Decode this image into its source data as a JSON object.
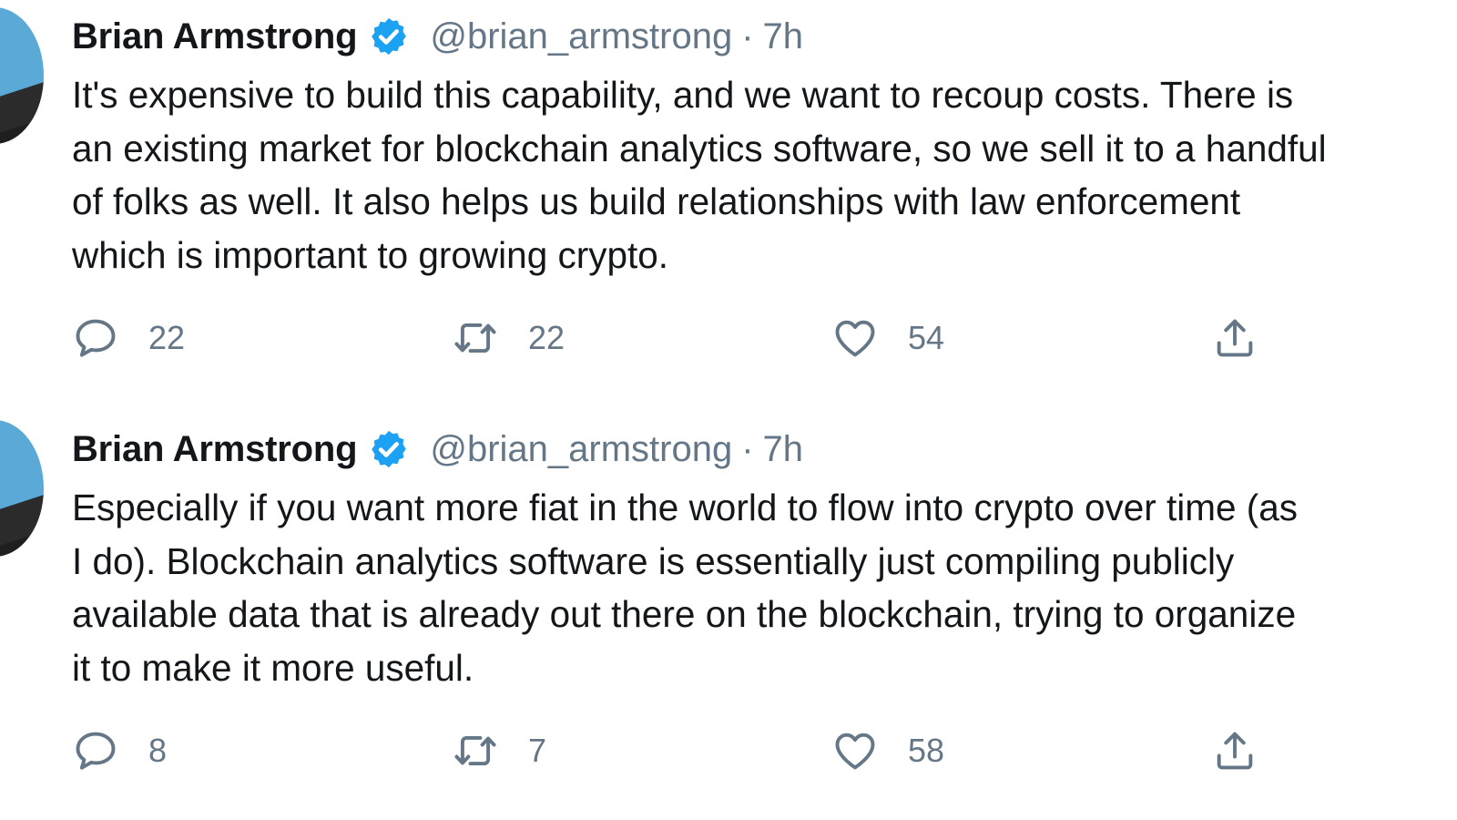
{
  "tweets": [
    {
      "author": "Brian Armstrong",
      "handle": "@brian_armstrong",
      "separator": "·",
      "time": "7h",
      "lines": [
        "It's expensive to build this capability, and we want to recoup costs. There is",
        "an existing market for blockchain analytics software, so we sell it to a handful",
        "of folks as well. It also helps us build relationships with law enforcement",
        "which is important to growing crypto."
      ],
      "replies": "22",
      "retweets": "22",
      "likes": "54"
    },
    {
      "author": "Brian Armstrong",
      "handle": "@brian_armstrong",
      "separator": "·",
      "time": "7h",
      "lines": [
        "Especially if you want more fiat in the world to flow into crypto over time (as",
        "I do). Blockchain analytics software is essentially just compiling publicly",
        "available data that is already out there on the blockchain, trying to organize",
        "it to make it more useful."
      ],
      "replies": "8",
      "retweets": "7",
      "likes": "58"
    }
  ],
  "colors": {
    "verified": "#1da1f2",
    "muted": "#657786",
    "text": "#14171a"
  },
  "icons": [
    "verified-badge-icon",
    "reply-icon",
    "retweet-icon",
    "like-icon",
    "share-icon"
  ]
}
